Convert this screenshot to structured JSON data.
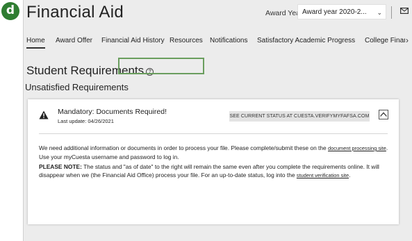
{
  "figure": {
    "badge_letter": "d"
  },
  "header": {
    "title": "Financial Aid",
    "award_year_label": "Award Year:",
    "award_year_value": "Award year 2020-2...",
    "mail_icon": "mail-icon"
  },
  "tabs": [
    {
      "label": "Home",
      "active": true
    },
    {
      "label": "Award Offer"
    },
    {
      "label": "Financial Aid History"
    },
    {
      "label": "Resources"
    },
    {
      "label": "Notifications"
    },
    {
      "label": "Satisfactory Academic Progress"
    },
    {
      "label": "College Finan"
    }
  ],
  "main": {
    "section_title": "Student Requirements",
    "help_icon": "help-icon",
    "subsection_title": "Unsatisfied Requirements"
  },
  "requirement": {
    "title": "Mandatory: Documents Required!",
    "last_update": "Last update: 04/26/2021",
    "status_button": "SEE CURRENT STATUS AT CUESTA.VERIFYMYFAFSA.COM",
    "para1_text": "We need additional information or documents in order to process your file. Please complete/submit these on the ",
    "para1_link": "document processing site",
    "para1_tail": ". Use your myCuesta username and password to log in.",
    "para2_label": "PLEASE NOTE:",
    "para2_text": " The status and \"as of date\" to the right will remain the same even after you complete the requirements online. It will disappear when we (the Financial Aid Office) process your file. For an up-to-date status, log into the ",
    "para2_link": "student verification site",
    "para2_tail": "."
  },
  "colors": {
    "badge": "#2f7d32",
    "highlight": "#6a9e5e",
    "page_bg": "#ececec"
  }
}
